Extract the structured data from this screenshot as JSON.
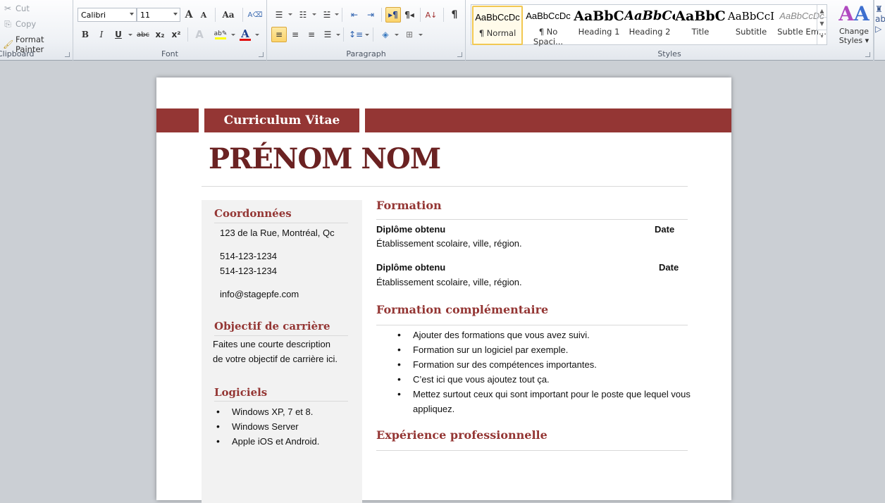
{
  "ribbon": {
    "clipboard": {
      "label": "Clipboard",
      "cut": "Cut",
      "copy": "Copy",
      "format_painter": "Format Painter"
    },
    "font": {
      "label": "Font",
      "family": "Calibri",
      "size": "11",
      "grow": "A",
      "shrink": "A",
      "change_case": "Aa",
      "bold": "B",
      "italic": "I",
      "underline": "U",
      "strike": "abc",
      "subscript": "x₂",
      "superscript": "x²",
      "highlight_color": "#ffff00",
      "font_color": "#e01010"
    },
    "paragraph": {
      "label": "Paragraph",
      "pilcrow": "¶"
    },
    "styles": {
      "label": "Styles",
      "items": [
        {
          "preview": "AaBbCcDc",
          "name": "¶ Normal",
          "selected": true
        },
        {
          "preview": "AaBbCcDc",
          "name": "¶ No Spaci...",
          "selected": false
        },
        {
          "preview": "AaBbC",
          "name": "Heading 1",
          "selected": false
        },
        {
          "preview": "AaBbCc",
          "name": "Heading 2",
          "selected": false
        },
        {
          "preview": "AaBbC",
          "name": "Title",
          "selected": false
        },
        {
          "preview": "AaBbCcI",
          "name": "Subtitle",
          "selected": false
        },
        {
          "preview": "AaBbCcDc",
          "name": "Subtle Em...",
          "selected": false
        }
      ],
      "change_styles_line1": "Change",
      "change_styles_line2": "Styles"
    }
  },
  "document": {
    "accent_color": "#943634",
    "banner_title": "Curriculum Vitae",
    "name": "PRÉNOM NOM",
    "sidebar": {
      "contact_heading": "Coordonnées",
      "address": "123  de la Rue, Montréal, Qc",
      "phone1": "514-123-1234",
      "phone2": "514-123-1234",
      "email": "info@stagepfe.com",
      "objective_heading": "Objectif de carrière",
      "objective_line1": "Faites une courte description",
      "objective_line2": "de votre objectif de carrière ici.",
      "software_heading": "Logiciels",
      "software": [
        "Windows XP, 7 et 8.",
        "Windows Server",
        "Apple iOS et Android."
      ]
    },
    "main": {
      "education_heading": "Formation",
      "education": [
        {
          "degree": "Diplôme obtenu",
          "date": "Date",
          "school": "Établissement scolaire, ville, région."
        },
        {
          "degree": "Diplôme obtenu",
          "date": "Date",
          "school": "Établissement scolaire, ville, région."
        }
      ],
      "extra_heading": "Formation complémentaire",
      "extra": [
        "Ajouter des formations que vous avez suivi.",
        "Formation sur un logiciel par exemple.",
        "Formation sur des compétences importantes.",
        "C’est ici que vous ajoutez tout ça.",
        "Mettez surtout ceux qui sont important pour le poste que lequel vous appliquez."
      ],
      "experience_heading": "Expérience professionnelle"
    }
  }
}
